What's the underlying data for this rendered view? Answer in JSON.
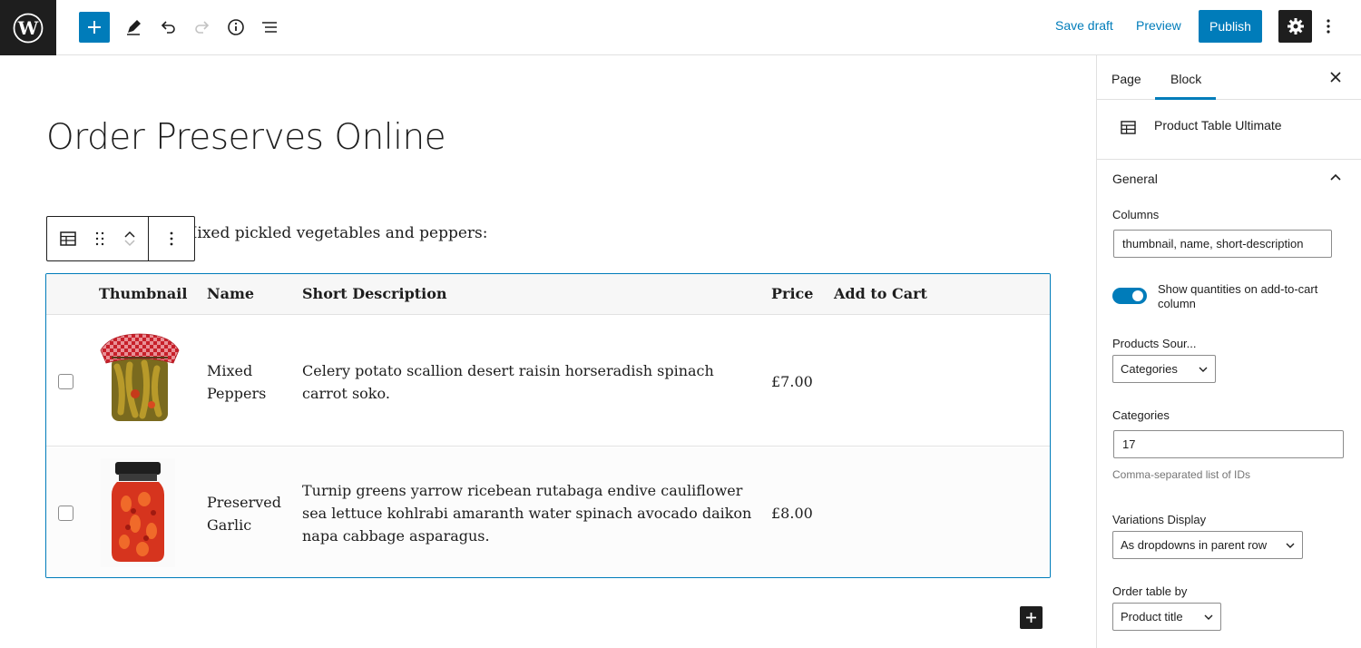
{
  "toolbar": {
    "save_draft": "Save draft",
    "preview": "Preview",
    "publish": "Publish"
  },
  "editor": {
    "page_title": "Order Preserves Online",
    "intro_text": "Mixed pickled vegetables and peppers:",
    "table": {
      "headers": [
        "Thumbnail",
        "Name",
        "Short Description",
        "Price",
        "Add to Cart"
      ],
      "rows": [
        {
          "name_line1": "Mixed",
          "name_line2": "Peppers",
          "desc_line1": "Celery potato scallion desert raisin horseradish spinach",
          "desc_line2": "carrot soko.",
          "price": "£7.00"
        },
        {
          "name_line1": "Preserved",
          "name_line2": "Garlic",
          "desc_line1": "Turnip greens yarrow ricebean rutabaga endive cauliflower",
          "desc_line2": "sea lettuce kohlrabi amaranth water spinach avocado daikon",
          "desc_line3": "napa cabbage asparagus.",
          "price": "£8.00"
        }
      ]
    }
  },
  "sidebar": {
    "tabs": [
      "Page",
      "Block"
    ],
    "active_tab": "Block",
    "block_name": "Product Table Ultimate",
    "panel_title": "General",
    "columns_label": "Columns",
    "columns_value": "thumbnail, name, short-description",
    "toggle_label": "Show quantities on add-to-cart column",
    "toggle_on": true,
    "products_source_label": "Products Sour...",
    "products_source_value": "Categories",
    "categories_label": "Categories",
    "categories_value": "17",
    "categories_help": "Comma-separated list of IDs",
    "variations_label": "Variations Display",
    "variations_value": "As dropdowns in parent row",
    "order_label": "Order table by",
    "order_value": "Product title"
  },
  "colors": {
    "accent": "#007cba",
    "dark": "#1e1e1e",
    "border": "#e0e0e0"
  }
}
